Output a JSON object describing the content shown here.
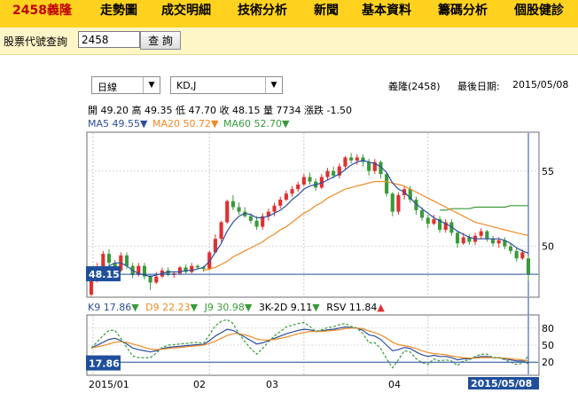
{
  "nav": {
    "title": "2458義隆",
    "items": [
      "走勢圖",
      "成交明細",
      "技術分析",
      "新聞",
      "基本資料",
      "籌碼分析",
      "個股健診"
    ]
  },
  "query": {
    "label": "股票代號查詢",
    "input_value": "2458",
    "button": "查 詢"
  },
  "controls": {
    "period": "日線",
    "indicator": "KD,J"
  },
  "info": {
    "stock": "義隆(2458)",
    "last_date_label": "最後日期:",
    "last_date": "2015/05/08"
  },
  "ohlc": {
    "open_label": "開",
    "open": "49.20",
    "high_label": "高",
    "high": "49.35",
    "low_label": "低",
    "low": "47.70",
    "close_label": "收",
    "close": "48.15",
    "vol_label": "量",
    "vol": "7734",
    "chg_label": "漲跌",
    "chg": "-1.50"
  },
  "ma": {
    "ma5": "MA5 49.55",
    "ma20": "MA20 50.72",
    "ma60": "MA60 52.70",
    "arrow": "▼"
  },
  "kd": {
    "k9": "K9 17.86",
    "d9": "D9 22.23",
    "j9": "J9 30.98",
    "kd3": "3K-2D 9.11",
    "rsv": "RSV 11.84",
    "down": "▼",
    "up": "▲"
  },
  "colors": {
    "topbar": "#ffd21f",
    "up": "#e03030",
    "down": "#3a9a3a",
    "ma5": "#2c4e9e",
    "ma20": "#f08a24",
    "ma60": "#3a9a3a",
    "label_box": "#1f4f9c"
  },
  "chart_data": [
    {
      "type": "candlestick",
      "title": "",
      "x": [
        "2015/01",
        "02",
        "03",
        "04",
        "2015/05/08"
      ],
      "y_ticks": [
        55,
        50
      ],
      "ylim": [
        46.8,
        57.4
      ],
      "current_label": "48.15",
      "candles": [
        [
          46.8,
          47.8,
          46.7,
          48.0
        ],
        [
          47.8,
          48.6,
          47.6,
          48.9
        ],
        [
          48.6,
          49.5,
          48.4,
          49.7
        ],
        [
          49.5,
          48.9,
          48.7,
          49.8
        ],
        [
          48.9,
          48.4,
          48.2,
          49.1
        ],
        [
          48.4,
          49.4,
          48.3,
          49.6
        ],
        [
          49.4,
          48.7,
          48.5,
          49.6
        ],
        [
          48.7,
          48.1,
          47.9,
          48.9
        ],
        [
          48.1,
          48.7,
          48.0,
          48.9
        ],
        [
          48.7,
          48.0,
          47.8,
          48.9
        ],
        [
          48.0,
          47.6,
          47.1,
          48.1
        ],
        [
          47.6,
          48.0,
          47.5,
          48.3
        ],
        [
          48.0,
          48.4,
          47.9,
          48.6
        ],
        [
          48.4,
          48.1,
          48.0,
          48.6
        ],
        [
          48.1,
          48.2,
          47.9,
          48.3
        ],
        [
          48.2,
          48.6,
          48.1,
          48.7
        ],
        [
          48.6,
          48.3,
          48.2,
          48.8
        ],
        [
          48.3,
          48.7,
          48.2,
          48.9
        ],
        [
          48.7,
          48.6,
          48.5,
          48.8
        ],
        [
          48.6,
          48.5,
          48.3,
          48.7
        ],
        [
          48.5,
          49.6,
          48.4,
          49.7
        ],
        [
          49.6,
          50.5,
          49.6,
          50.8
        ],
        [
          50.5,
          51.6,
          50.3,
          51.7
        ],
        [
          51.6,
          53.0,
          51.5,
          53.1
        ],
        [
          53.0,
          52.6,
          52.4,
          53.4
        ],
        [
          52.6,
          52.3,
          52.1,
          52.9
        ],
        [
          52.3,
          52.0,
          51.9,
          52.6
        ],
        [
          52.0,
          51.7,
          51.5,
          52.2
        ],
        [
          51.7,
          51.3,
          51.1,
          52.0
        ],
        [
          51.3,
          52.0,
          51.1,
          52.2
        ],
        [
          52.0,
          52.3,
          51.7,
          52.5
        ],
        [
          52.3,
          52.7,
          52.0,
          52.9
        ],
        [
          52.7,
          53.1,
          52.5,
          53.3
        ],
        [
          53.1,
          53.5,
          53.0,
          53.7
        ],
        [
          53.5,
          53.8,
          53.3,
          54.0
        ],
        [
          53.8,
          54.1,
          53.6,
          54.3
        ],
        [
          54.1,
          54.6,
          54.0,
          54.8
        ],
        [
          54.6,
          54.3,
          54.1,
          54.9
        ],
        [
          54.3,
          53.9,
          53.7,
          54.5
        ],
        [
          53.9,
          54.6,
          53.8,
          54.8
        ],
        [
          54.6,
          55.0,
          54.4,
          55.2
        ],
        [
          55.0,
          54.7,
          54.5,
          55.3
        ],
        [
          54.7,
          55.3,
          54.5,
          55.5
        ],
        [
          55.3,
          55.9,
          55.1,
          56.0
        ],
        [
          55.9,
          55.7,
          55.5,
          56.2
        ],
        [
          55.7,
          55.9,
          55.4,
          56.1
        ],
        [
          55.9,
          55.6,
          55.3,
          56.1
        ],
        [
          55.6,
          55.0,
          54.7,
          55.8
        ],
        [
          55.0,
          55.6,
          54.8,
          55.8
        ],
        [
          55.6,
          54.8,
          54.5,
          55.7
        ],
        [
          54.8,
          53.5,
          53.3,
          54.9
        ],
        [
          53.5,
          52.3,
          52.0,
          53.6
        ],
        [
          52.3,
          53.4,
          52.1,
          53.6
        ],
        [
          53.4,
          53.8,
          53.1,
          54.0
        ],
        [
          53.8,
          53.1,
          52.9,
          54.0
        ],
        [
          53.1,
          52.4,
          52.1,
          53.3
        ],
        [
          52.4,
          51.9,
          51.7,
          52.6
        ],
        [
          51.9,
          51.5,
          51.2,
          52.1
        ],
        [
          51.5,
          51.8,
          51.4,
          52.1
        ],
        [
          51.8,
          51.1,
          50.9,
          52.0
        ],
        [
          51.1,
          51.6,
          50.9,
          51.8
        ],
        [
          51.6,
          50.9,
          50.7,
          51.8
        ],
        [
          50.9,
          50.2,
          49.9,
          51.0
        ],
        [
          50.2,
          50.6,
          50.1,
          50.9
        ],
        [
          50.6,
          50.3,
          50.1,
          50.8
        ],
        [
          50.3,
          50.7,
          50.1,
          50.9
        ],
        [
          50.7,
          51.0,
          50.5,
          51.2
        ],
        [
          51.0,
          50.5,
          50.3,
          51.1
        ],
        [
          50.5,
          50.2,
          50.0,
          50.7
        ],
        [
          50.2,
          50.4,
          49.9,
          50.6
        ],
        [
          50.4,
          50.0,
          49.8,
          50.6
        ],
        [
          50.0,
          49.7,
          49.5,
          50.2
        ],
        [
          49.7,
          49.2,
          49.0,
          49.9
        ],
        [
          49.2,
          49.6,
          49.1,
          49.8
        ],
        [
          49.2,
          48.15,
          47.7,
          49.35
        ]
      ],
      "ma5": [
        47.9,
        48.0,
        48.3,
        48.7,
        48.9,
        48.9,
        48.7,
        48.4,
        48.2,
        48.1,
        48.0,
        48.1,
        48.2,
        48.3,
        48.3,
        48.3,
        48.4,
        48.4,
        48.5,
        48.6,
        49.0,
        49.6,
        50.2,
        51.0,
        51.6,
        52.0,
        52.2,
        52.1,
        51.9,
        51.9,
        52.0,
        52.2,
        52.4,
        52.7,
        53.1,
        53.4,
        53.8,
        54.0,
        54.1,
        54.2,
        54.4,
        54.6,
        54.8,
        55.1,
        55.4,
        55.6,
        55.7,
        55.6,
        55.5,
        55.3,
        54.9,
        54.2,
        53.8,
        53.6,
        53.2,
        52.8,
        52.5,
        52.2,
        51.9,
        51.7,
        51.5,
        51.3,
        51.0,
        50.8,
        50.6,
        50.5,
        50.5,
        50.5,
        50.5,
        50.5,
        50.4,
        50.2,
        49.9,
        49.7,
        49.55
      ],
      "ma20": [
        null,
        null,
        null,
        null,
        null,
        null,
        null,
        null,
        null,
        null,
        null,
        null,
        null,
        null,
        null,
        null,
        null,
        null,
        null,
        48.4,
        48.5,
        48.6,
        48.8,
        49.0,
        49.3,
        49.5,
        49.7,
        49.9,
        50.1,
        50.3,
        50.6,
        50.8,
        51.1,
        51.3,
        51.6,
        51.9,
        52.2,
        52.4,
        52.7,
        52.9,
        53.2,
        53.4,
        53.6,
        53.8,
        53.9,
        54.0,
        54.1,
        54.2,
        54.3,
        54.3,
        54.3,
        54.2,
        54.1,
        54.0,
        53.8,
        53.6,
        53.4,
        53.2,
        53.0,
        52.8,
        52.6,
        52.4,
        52.2,
        52.0,
        51.8,
        51.6,
        51.5,
        51.4,
        51.3,
        51.2,
        51.1,
        51.0,
        50.9,
        50.8,
        50.72
      ],
      "ma60": [
        null,
        null,
        null,
        null,
        null,
        null,
        null,
        null,
        null,
        null,
        null,
        null,
        null,
        null,
        null,
        null,
        null,
        null,
        null,
        null,
        null,
        null,
        null,
        null,
        null,
        null,
        null,
        null,
        null,
        null,
        null,
        null,
        null,
        null,
        null,
        null,
        null,
        null,
        null,
        null,
        null,
        null,
        null,
        null,
        null,
        null,
        null,
        null,
        null,
        null,
        null,
        null,
        null,
        null,
        null,
        null,
        null,
        null,
        null,
        52.4,
        52.4,
        52.5,
        52.5,
        52.5,
        52.5,
        52.6,
        52.6,
        52.6,
        52.6,
        52.6,
        52.6,
        52.7,
        52.7,
        52.7,
        52.7
      ]
    },
    {
      "type": "line",
      "title": "",
      "y_ticks": [
        80,
        50,
        20
      ],
      "ylim": [
        0,
        100
      ],
      "current_label": "17.86",
      "ref_line": 20,
      "series": [
        {
          "name": "K9",
          "values": [
            45,
            50,
            55,
            60,
            62,
            58,
            52,
            45,
            42,
            40,
            38,
            40,
            44,
            46,
            47,
            48,
            49,
            50,
            51,
            51,
            58,
            66,
            72,
            78,
            76,
            70,
            64,
            58,
            52,
            54,
            58,
            62,
            66,
            70,
            73,
            76,
            78,
            77,
            74,
            75,
            77,
            78,
            80,
            82,
            81,
            80,
            76,
            68,
            66,
            60,
            50,
            40,
            42,
            46,
            44,
            38,
            33,
            30,
            32,
            30,
            30,
            28,
            24,
            26,
            26,
            28,
            30,
            30,
            28,
            28,
            26,
            24,
            22,
            22,
            17.86
          ]
        },
        {
          "name": "D9",
          "values": [
            45,
            47,
            49,
            52,
            55,
            56,
            55,
            52,
            49,
            46,
            43,
            42,
            43,
            44,
            45,
            46,
            47,
            48,
            49,
            50,
            53,
            57,
            62,
            67,
            70,
            70,
            68,
            65,
            61,
            59,
            59,
            60,
            62,
            64,
            67,
            70,
            72,
            74,
            74,
            74,
            75,
            76,
            77,
            79,
            80,
            80,
            79,
            75,
            72,
            68,
            62,
            55,
            51,
            49,
            47,
            44,
            40,
            37,
            35,
            34,
            33,
            31,
            29,
            28,
            27,
            27,
            28,
            28,
            28,
            28,
            27,
            26,
            25,
            24,
            22.23
          ]
        },
        {
          "name": "J9",
          "values": [
            45,
            56,
            67,
            76,
            76,
            62,
            46,
            31,
            28,
            28,
            28,
            36,
            46,
            50,
            51,
            52,
            53,
            54,
            55,
            53,
            68,
            84,
            92,
            95,
            88,
            70,
            56,
            44,
            34,
            44,
            56,
            66,
            74,
            82,
            85,
            88,
            90,
            83,
            74,
            77,
            81,
            82,
            86,
            88,
            83,
            80,
            70,
            54,
            54,
            44,
            26,
            10,
            24,
            40,
            38,
            26,
            19,
            16,
            26,
            22,
            24,
            22,
            14,
            22,
            24,
            30,
            34,
            34,
            28,
            28,
            24,
            20,
            16,
            18,
            30.98
          ]
        }
      ]
    }
  ]
}
